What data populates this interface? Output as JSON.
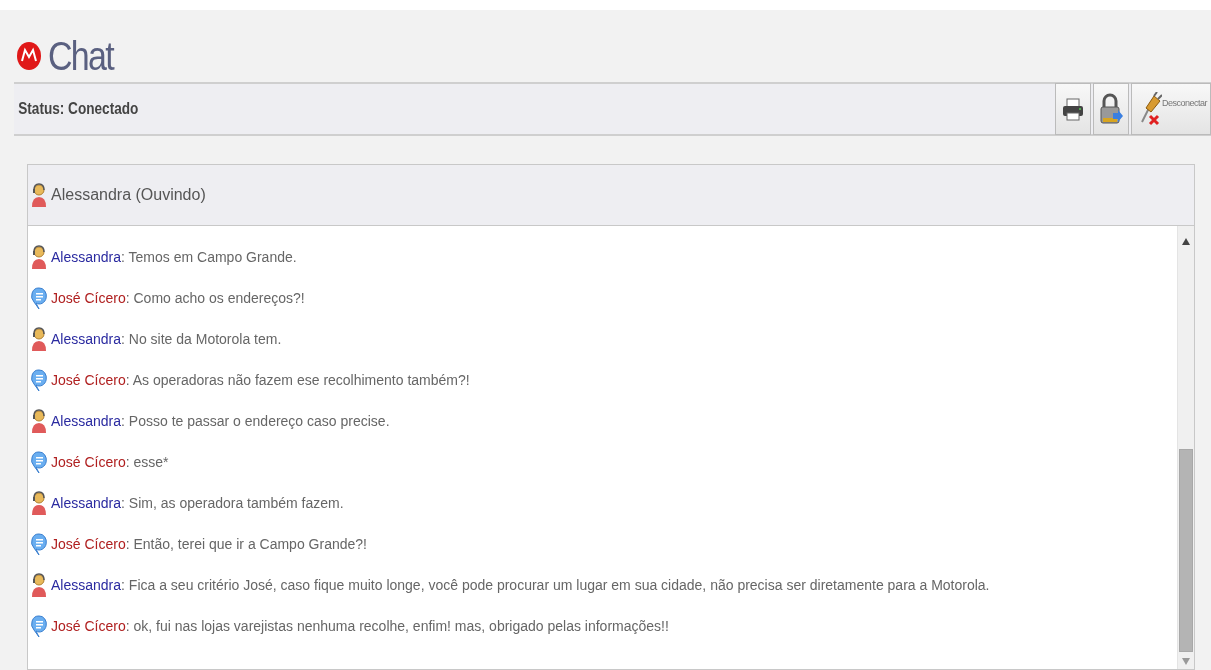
{
  "header": {
    "title": "Chat"
  },
  "status_bar": {
    "status": "Status: Conectado",
    "buttons": [
      {
        "kind": "print"
      },
      {
        "kind": "lock"
      },
      {
        "kind": "disconnect",
        "label": "Desconectar"
      }
    ]
  },
  "chat": {
    "participant": {
      "kind": "agent",
      "label": "Alessandra (Ouvindo)"
    },
    "messages": [
      {
        "kind": "agent",
        "sender": "Alessandra",
        "text": ": Temos em Campo Grande."
      },
      {
        "kind": "customer",
        "sender": "José Cícero",
        "text": ": Como acho os endereços?!"
      },
      {
        "kind": "agent",
        "sender": "Alessandra",
        "text": ": No site da Motorola tem."
      },
      {
        "kind": "customer",
        "sender": "José Cícero",
        "text": ": As operadoras não fazem ese recolhimento também?!"
      },
      {
        "kind": "agent",
        "sender": "Alessandra",
        "text": ": Posso te passar o endereço caso precise."
      },
      {
        "kind": "customer",
        "sender": "José Cícero",
        "text": ": esse*"
      },
      {
        "kind": "agent",
        "sender": "Alessandra",
        "text": ": Sim, as operadora também fazem."
      },
      {
        "kind": "customer",
        "sender": "José Cícero",
        "text": ": Então, terei que ir a Campo Grande?!"
      },
      {
        "kind": "agent",
        "sender": "Alessandra",
        "text": ": Fica a seu critério José, caso fique muito longe, você pode procurar um lugar em sua cidade, não precisa ser diretamente para a Motorola."
      },
      {
        "kind": "customer",
        "sender": "José Cícero",
        "text": ": ok, fui nas lojas varejistas nenhuma recolhe, enfim! mas, obrigado pelas informações!!"
      }
    ]
  }
}
